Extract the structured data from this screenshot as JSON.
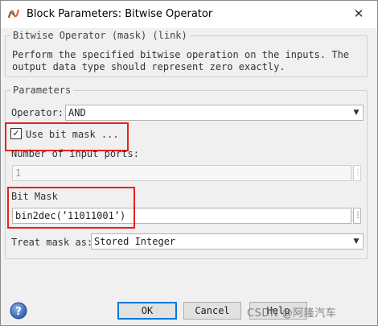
{
  "window": {
    "title": "Block Parameters: Bitwise Operator",
    "close_symbol": "✕"
  },
  "block_group": {
    "legend": "Bitwise Operator (mask) (link)",
    "description": "Perform the specified bitwise operation on the inputs. The output data type should represent zero exactly."
  },
  "parameters": {
    "legend": "Parameters",
    "operator_label": "Operator:",
    "operator_value": "AND",
    "use_bit_mask_label": "Use bit mask ...",
    "use_bit_mask_checked": true,
    "check_symbol": "✓",
    "num_ports_label": "Number of input ports:",
    "num_ports_value": "1",
    "bit_mask_label": "Bit Mask",
    "bit_mask_value": "bin2dec(’11011001’)",
    "treat_mask_label": "Treat mask as:",
    "treat_mask_value": "Stored Integer",
    "dropdown_arrow": "▼",
    "more_symbol": "⋮"
  },
  "buttons": {
    "ok": "OK",
    "cancel": "Cancel",
    "help": "Help"
  },
  "watermark": "CSDN @阿隆汽车",
  "highlight_color": "#e8201e",
  "icons": [
    "simulink-icon",
    "close-icon",
    "help-icon"
  ]
}
